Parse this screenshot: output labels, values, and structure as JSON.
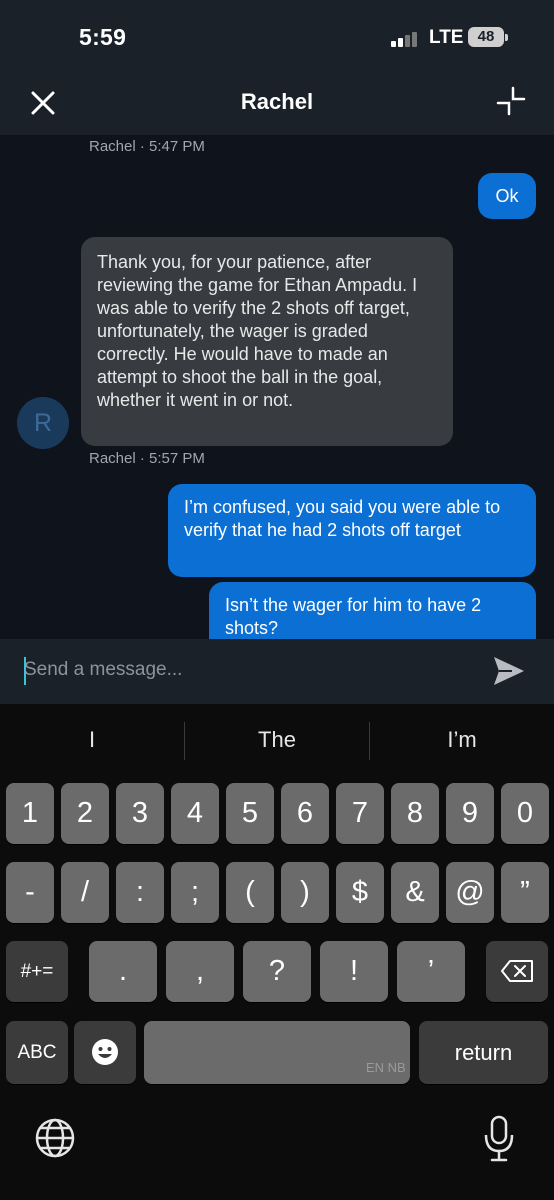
{
  "status": {
    "time": "5:59",
    "network": "LTE",
    "battery": "48"
  },
  "header": {
    "title": "Rachel",
    "close_icon": "close-icon",
    "minimize_icon": "minimize-icon"
  },
  "chat": {
    "meta1": "Rachel · 5:47 PM",
    "user_msg1": "Ok",
    "agent_msg": "Thank you, for your patience, after reviewing the game for Ethan Ampadu. I was able to verify the 2 shots off target, unfortunately, the wager is graded correctly. He would have to made an attempt to shoot the ball in the goal, whether it went in or not.",
    "avatar_initial": "R",
    "meta2": "Rachel · 5:57 PM",
    "user_msg2": "I’m confused, you said you were able to verify that he had 2 shots off target",
    "user_msg3": "Isn’t the wager for him to have 2 shots?"
  },
  "composer": {
    "placeholder": "Send a message...",
    "send_icon": "send-icon"
  },
  "keyboard": {
    "suggestions": [
      "I",
      "The",
      "I’m"
    ],
    "row1": [
      "1",
      "2",
      "3",
      "4",
      "5",
      "6",
      "7",
      "8",
      "9",
      "0"
    ],
    "row2": [
      "-",
      "/",
      ":",
      ";",
      "(",
      ")",
      "$",
      "&",
      "@",
      "”"
    ],
    "row3": [
      "#+=",
      ".",
      ",",
      "?",
      "!",
      "’"
    ],
    "abc": "ABC",
    "return": "return",
    "lang": "EN NB",
    "icons": [
      "backspace-icon",
      "emoji-icon",
      "globe-icon",
      "microphone-icon"
    ]
  }
}
